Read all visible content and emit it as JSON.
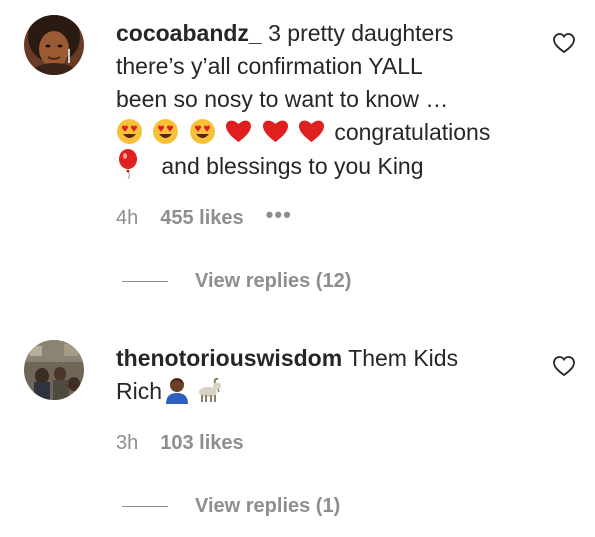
{
  "comments": [
    {
      "username": "cocoabandz_",
      "text_line1": "3 pretty daughters",
      "text_line2": "there’s y’all confirmation YALL",
      "text_line3": "been so nosy to want to know …",
      "text_line4": "congratulations",
      "text_line5": "and blessings to you King",
      "emojis_line4": [
        "heart-eyes",
        "heart-eyes",
        "heart-eyes",
        "red-heart",
        "red-heart",
        "red-heart"
      ],
      "emoji_line5": "balloon",
      "time": "4h",
      "likes": "455 likes",
      "more": "•••",
      "replies_label": "View replies (12)"
    },
    {
      "username": "thenotoriouswisdom",
      "text_line1": "Them Kids",
      "text_line2": "Rich",
      "emojis_line2": [
        "man-dark-skin",
        "goat"
      ],
      "time": "3h",
      "likes": "103 likes",
      "replies_label": "View replies (1)"
    }
  ],
  "colors": {
    "text": "#262626",
    "muted": "#8e8e8e",
    "heart": "#e0201f"
  }
}
